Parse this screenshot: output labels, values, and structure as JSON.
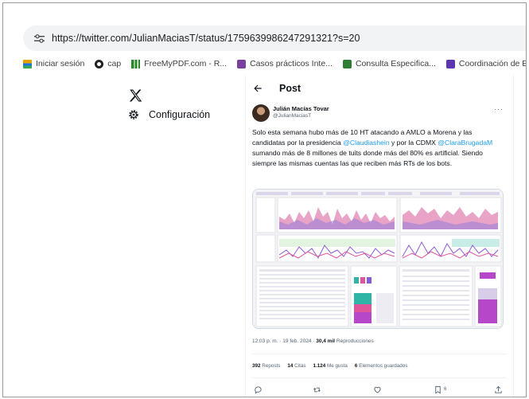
{
  "browser": {
    "url": "https://twitter.com/JulianMaciasT/status/1759639986247291321?s=20",
    "bookmarks": [
      {
        "label": "Iniciar sesión",
        "icon": "login-icon"
      },
      {
        "label": "cap",
        "icon": "cap-icon"
      },
      {
        "label": "FreeMyPDF.com - R...",
        "icon": "pdf-icon"
      },
      {
        "label": "Casos prácticos Inte...",
        "icon": "casos-icon"
      },
      {
        "label": "Consulta Especifica...",
        "icon": "consulta-icon"
      },
      {
        "label": "Coordinación de E",
        "icon": "coordinacion-icon"
      }
    ]
  },
  "nav": {
    "settings_label": "Configuración"
  },
  "post": {
    "header": "Post",
    "author_name": "Julián Macías Tovar",
    "author_handle": "@JulianMaciasT",
    "text_1": "Solo esta semana hubo más de 10 HT atacando a AMLO a Morena y las candidatas por la presidencia ",
    "mention_1": "@Claudiashein",
    "text_2": " y por la CDMX ",
    "mention_2": "@ClaraBrugadaM",
    "text_3": " sumando más de 8 millones de tuits donde más del 80% es artificial. Siendo siempre las mismas cuentas las que reciben más RTs de los bots.",
    "time": "12:03 p. m. · 19 feb. 2024 · ",
    "views": "30,4 mil",
    "views_label": " Reproducciones",
    "reposts": "392",
    "reposts_label": " Reposts",
    "quotes": "14",
    "quotes_label": " Citas",
    "likes": "1.124",
    "likes_label": " Me gusta",
    "bookmarks": "6",
    "bookmarks_label": " Elementos guardados",
    "bookmark_count": "6"
  },
  "colors": {
    "link": "#1d9bf0",
    "chart_pink": "#e0559a",
    "chart_purple": "#8a5bd6",
    "chart_teal": "#2fb5a5",
    "chart_magenta": "#b547c8"
  }
}
